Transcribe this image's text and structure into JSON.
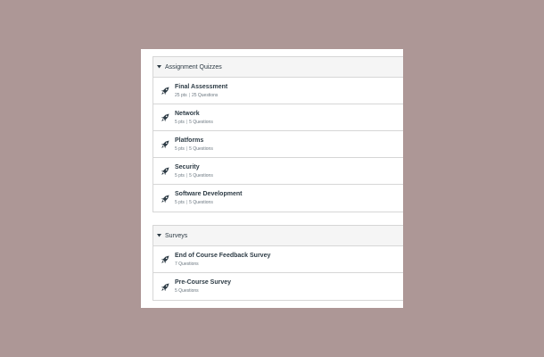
{
  "groups": [
    {
      "title": "Assignment Quizzes",
      "items": [
        {
          "title": "Final Assessment",
          "pts": "25 pts",
          "sep": "|",
          "questions": "25 Questions"
        },
        {
          "title": "Network",
          "pts": "5 pts",
          "sep": "|",
          "questions": "5 Questions"
        },
        {
          "title": "Platforms",
          "pts": "5 pts",
          "sep": "|",
          "questions": "5 Questions"
        },
        {
          "title": "Security",
          "pts": "5 pts",
          "sep": "|",
          "questions": "5 Questions"
        },
        {
          "title": "Software Development",
          "pts": "5 pts",
          "sep": "|",
          "questions": "5 Questions"
        }
      ]
    },
    {
      "title": "Surveys",
      "items": [
        {
          "title": "End of Course Feedback Survey",
          "questions": "7 Questions"
        },
        {
          "title": "Pre-Course Survey",
          "questions": "5 Questions"
        }
      ]
    }
  ],
  "icons": {
    "caret": "caret-down-icon",
    "item": "rocket-icon"
  },
  "colors": {
    "background": "#ad9796",
    "header": "#f5f5f5",
    "text": "#2d3b45",
    "muted": "#6b7780",
    "border": "#d6d6d6"
  }
}
